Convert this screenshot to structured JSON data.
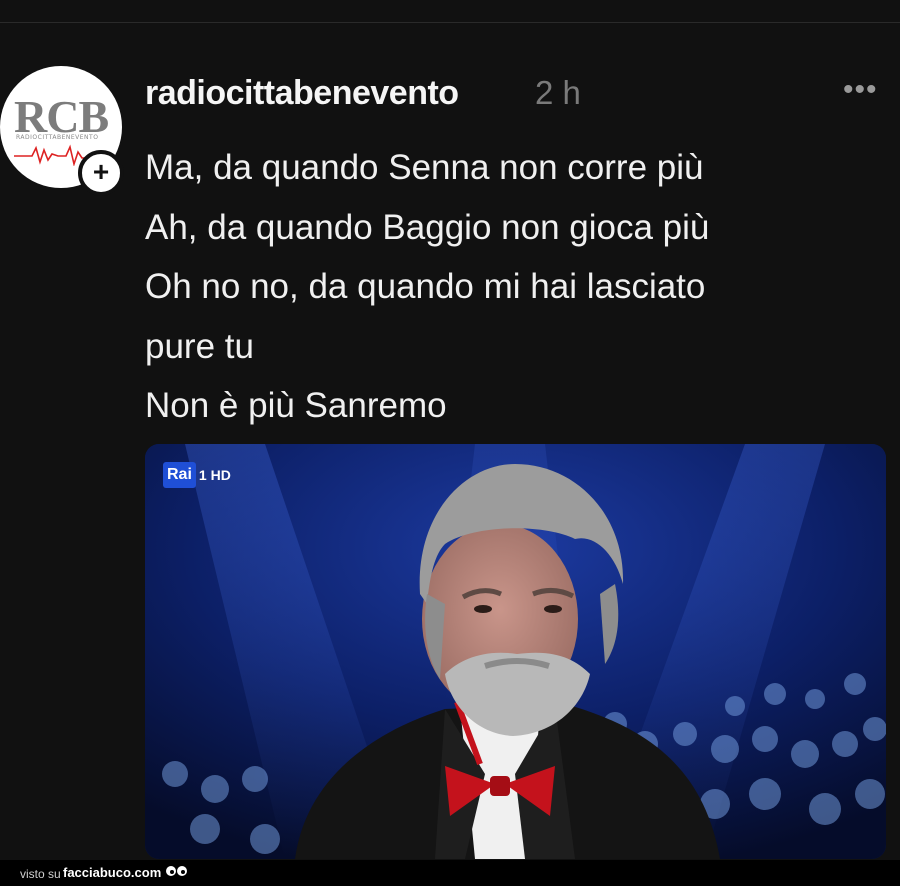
{
  "post": {
    "avatar_text": "RCB",
    "avatar_subtext": "RADIOCITTABENEVENTO",
    "username": "radiocittabenevento",
    "time": "2 h",
    "more": "•••",
    "lines": [
      "Ma, da quando Senna non corre più",
      "Ah, da quando Baggio non gioca più",
      "Oh no no, da quando mi hai lasciato",
      "pure tu",
      "Non è più Sanremo"
    ]
  },
  "media": {
    "channel_badge": "Rai",
    "channel_number": "1 HD"
  },
  "footer": {
    "label": "visto su",
    "site": "facciabuco.com"
  },
  "colors": {
    "background": "#111111",
    "stage_blue": "#0a1a55",
    "bow_tie": "#c4121c"
  }
}
